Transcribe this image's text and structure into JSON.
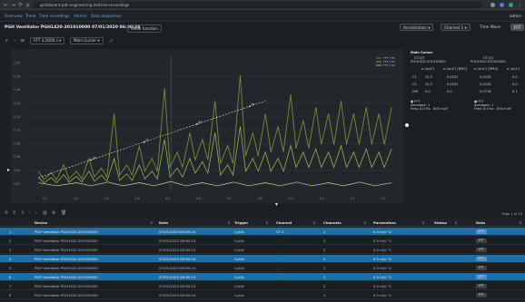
{
  "browser": {
    "url": "gridsboard.pdt-engineering.de/time-recordings",
    "colors": {
      "ext1": "#4f7fd0",
      "ext2": "#8a8f95",
      "ext3": "#2fa35c"
    }
  },
  "nav": {
    "links": [
      "Overview",
      "Trend",
      "Time recordings",
      "Alarms",
      "Data acquisition"
    ],
    "user": "admin"
  },
  "header": {
    "title": "PGH Ventilator PGH1420-201910000 07/01/2020 06:50:24",
    "show_function": "Show function",
    "acceleration": "Acceleration",
    "channel": "Channel 1",
    "time_wave": "Time Wave",
    "badge": "FFT"
  },
  "toolbar": {
    "fft_label": "FFT 3.2000 s",
    "mode_label": "Main Cursor"
  },
  "chart_data": {
    "type": "line",
    "title": "",
    "xlabel": "",
    "ylabel": "",
    "legend": "top-right",
    "legend_labels": [
      "FFT 7 Hz",
      "FFT 3 Hz",
      "FFT 1 Hz"
    ],
    "x_ticks": [
      "0.1",
      "0.2",
      "0.3",
      "0.4",
      "0.5",
      "0.6",
      "0.7",
      "0.8",
      "0.9",
      "1.0",
      "1.1",
      "1.2"
    ],
    "y_ticks": [
      "0.20",
      "0.18",
      "0.16",
      "0.14",
      "0.12",
      "0.10",
      "0.08",
      "0.06",
      "0.04",
      "0.02"
    ],
    "markers": [
      "1X",
      "2X",
      "3X",
      "4X"
    ],
    "series": [
      {
        "color": "#6f8f3a",
        "x": [
          0.08,
          0.12,
          0.16,
          0.2,
          0.24,
          0.28,
          0.32,
          0.36,
          0.4,
          0.44,
          0.48,
          0.52,
          0.56,
          0.6,
          0.64,
          0.68,
          0.72,
          0.76,
          0.8,
          0.84,
          0.88,
          0.92,
          0.96,
          1.0,
          1.04,
          1.08,
          1.12,
          1.16,
          1.2
        ],
        "y": [
          0.03,
          0.028,
          0.04,
          0.03,
          0.05,
          0.035,
          0.12,
          0.04,
          0.07,
          0.05,
          0.16,
          0.06,
          0.09,
          0.08,
          0.14,
          0.07,
          0.18,
          0.09,
          0.12,
          0.1,
          0.15,
          0.11,
          0.13,
          0.12,
          0.14,
          0.12,
          0.13,
          0.12,
          0.13
        ]
      },
      {
        "color": "#9cc45a",
        "x": [
          0.08,
          0.12,
          0.16,
          0.2,
          0.24,
          0.28,
          0.32,
          0.36,
          0.4,
          0.44,
          0.48,
          0.52,
          0.56,
          0.6,
          0.64,
          0.68,
          0.72,
          0.76,
          0.8,
          0.84,
          0.88,
          0.92,
          0.96,
          1.0,
          1.04,
          1.08,
          1.12,
          1.16,
          1.2
        ],
        "y": [
          0.02,
          0.02,
          0.025,
          0.022,
          0.03,
          0.024,
          0.05,
          0.026,
          0.04,
          0.03,
          0.08,
          0.035,
          0.05,
          0.045,
          0.09,
          0.04,
          0.1,
          0.05,
          0.06,
          0.05,
          0.07,
          0.06,
          0.065,
          0.06,
          0.07,
          0.06,
          0.065,
          0.06,
          0.065
        ]
      },
      {
        "color": "#c9d98a",
        "x": [
          0.08,
          0.2,
          0.3,
          0.4,
          0.5,
          0.6,
          0.7,
          0.8,
          0.9,
          1.0,
          1.1,
          1.2
        ],
        "y": [
          0.012,
          0.012,
          0.013,
          0.012,
          0.014,
          0.012,
          0.013,
          0.012,
          0.013,
          0.012,
          0.013,
          0.012
        ]
      }
    ],
    "harmonic_line": {
      "x": [
        0.08,
        0.8
      ],
      "y": [
        0.02,
        0.14
      ]
    },
    "ylim": [
      0,
      0.21
    ],
    "xlim": [
      0.05,
      1.22
    ]
  },
  "right_panel": {
    "heading": "Main Cursor",
    "col1": {
      "l1": "CT1(f)",
      "l2": "PGH1420-201910000"
    },
    "col2": {
      "l1": "CT1(f)",
      "l2": "PGH1420-201910000"
    },
    "units": [
      "a (m/s²)",
      "a (m/s²) [RMS]",
      "a (m/s²) [RMS]",
      "a (m/s²)"
    ],
    "rows": [
      {
        "label": "C1",
        "v1": "10.2",
        "v2": "0.0231",
        "v3": "0.0128",
        "v4": "0.0"
      },
      {
        "label": "C2",
        "v1": "10.2",
        "v2": "0.0231",
        "v3": "0.0128",
        "v4": "0.0"
      },
      {
        "label": "Diff",
        "v1": "0.0",
        "v2": "0.0",
        "v3": "0.0718",
        "v4": "0.1"
      }
    ],
    "note_left": [
      "● FFT",
      "Averages: 1",
      "Freq: 0.0 Hz - 800 m/s²"
    ],
    "note_right": [
      "● FFT",
      "Averages: 1",
      "Freq: 0.0 Hz - 800 m/s²"
    ]
  },
  "table": {
    "page_info": "Page 1 of 20",
    "headers": [
      "Device",
      "Date",
      "Trigger",
      "Channel",
      "Channels",
      "Parameters",
      "Status",
      "Data"
    ],
    "rows": [
      {
        "n": "1",
        "device": "PGH Ventilator PGH1420-201910000",
        "date": "07/01/2020 06:50:24",
        "trigger": "Cyclic",
        "channel": "CT 1",
        "channels": "2",
        "params": "0.5 m/s^2",
        "data": "FFT"
      },
      {
        "n": "2",
        "device": "PGH Ventilator PGH1420-201910000",
        "date": "07/01/2020 06:50:24",
        "trigger": "Cyclic",
        "channel": "-",
        "channels": "2",
        "params": "0.5 m/s^2",
        "data": "FFT"
      },
      {
        "n": "3",
        "device": "PGH Ventilator PGH1420-201910000",
        "date": "07/01/2020 06:50:24",
        "trigger": "Cyclic",
        "channel": "-",
        "channels": "2",
        "params": "0.5 m/s^2",
        "data": "FFT"
      },
      {
        "n": "4",
        "device": "PGH Ventilator PGH1420-201910000",
        "date": "07/01/2020 06:50:24",
        "trigger": "Cyclic",
        "channel": "-",
        "channels": "2",
        "params": "0.5 m/s^2",
        "data": "FFT"
      },
      {
        "n": "5",
        "device": "PGH Ventilator PGH1420-201910000",
        "date": "07/01/2020 06:50:24",
        "trigger": "Cyclic",
        "channel": "-",
        "channels": "2",
        "params": "0.5 m/s^2",
        "data": "FFT"
      },
      {
        "n": "6",
        "device": "PGH Ventilator PGH1420-201910000",
        "date": "07/01/2020 06:50:24",
        "trigger": "Cyclic",
        "channel": "-",
        "channels": "2",
        "params": "0.5 m/s^2",
        "data": "FFT"
      },
      {
        "n": "7",
        "device": "PGH Ventilator PGH1420-201910000",
        "date": "07/01/2020 06:50:24",
        "trigger": "Cyclic",
        "channel": "-",
        "channels": "2",
        "params": "0.5 m/s^2",
        "data": "FFT"
      },
      {
        "n": "8",
        "device": "PGH Ventilator PGH1420-201910000",
        "date": "07/01/2020 06:50:24",
        "trigger": "Cyclic",
        "channel": "-",
        "channels": "2",
        "params": "0.5 m/s^2",
        "data": "FFT"
      }
    ],
    "selected_rows": [
      0,
      3,
      5
    ],
    "colors": {
      "selected": "#1e6fa8"
    }
  }
}
